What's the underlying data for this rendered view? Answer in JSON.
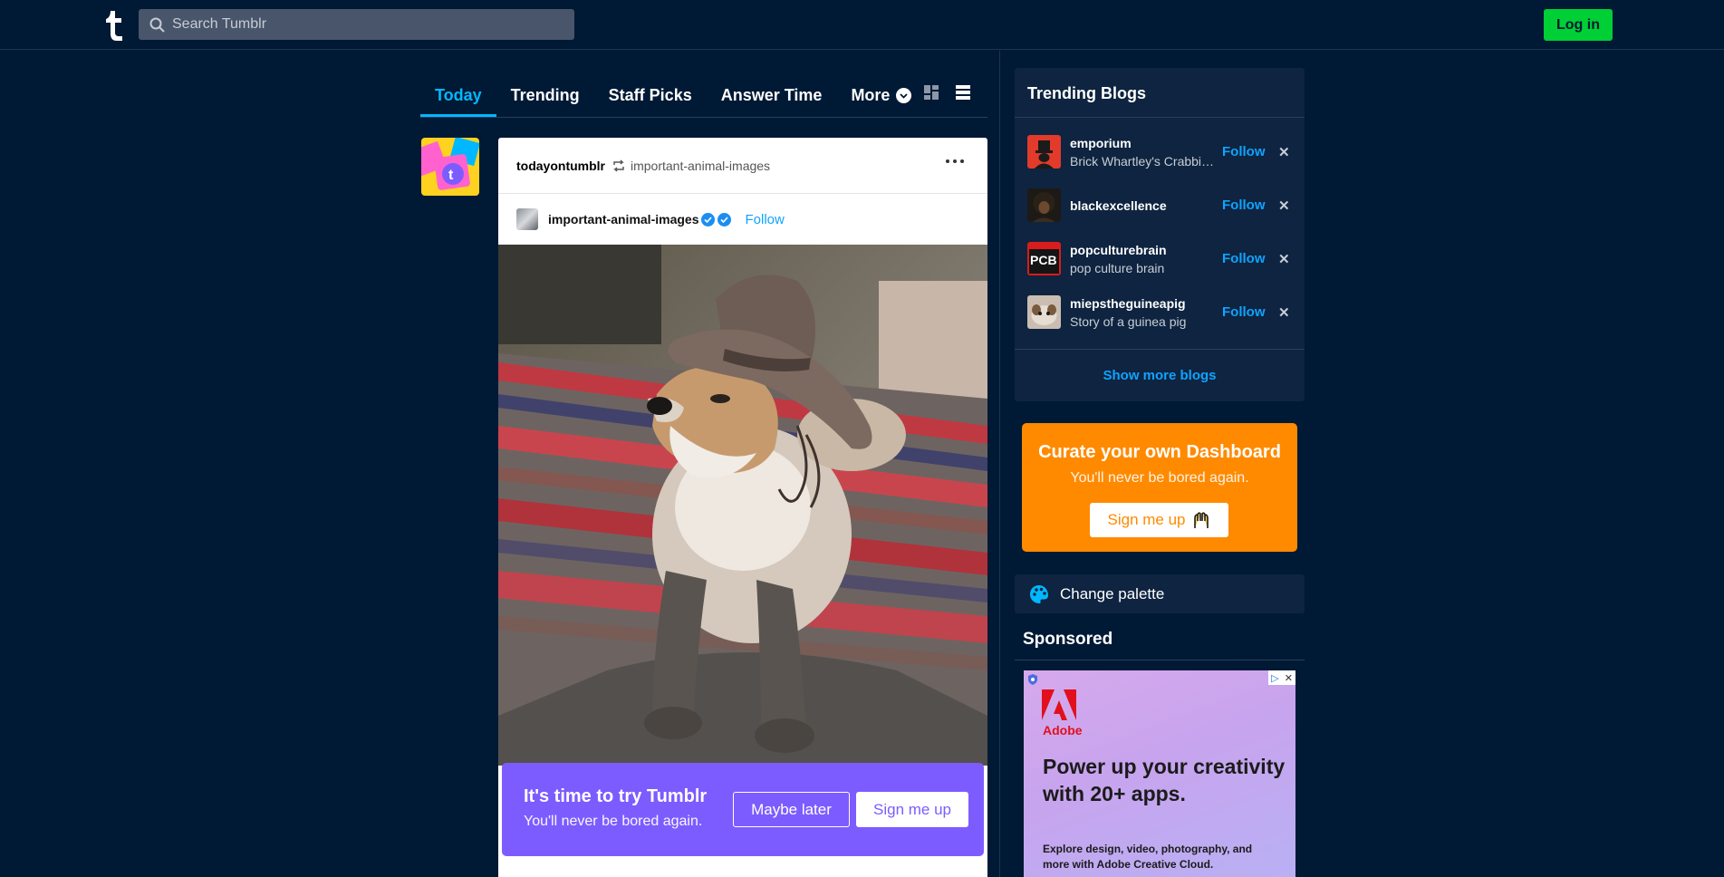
{
  "topbar": {
    "search_placeholder": "Search Tumblr",
    "login_label": "Log in"
  },
  "tabs": [
    {
      "label": "Today",
      "active": true
    },
    {
      "label": "Trending",
      "active": false
    },
    {
      "label": "Staff Picks",
      "active": false
    },
    {
      "label": "Answer Time",
      "active": false
    },
    {
      "label": "More",
      "active": false
    }
  ],
  "post": {
    "blog": "todayontumblr",
    "reblogged_from": "important-animal-images",
    "source_blog": "important-animal-images",
    "follow_label": "Follow"
  },
  "try_banner": {
    "title": "It's time to try Tumblr",
    "subtitle": "You'll never be bored again.",
    "maybe_label": "Maybe later",
    "signup_label": "Sign me up"
  },
  "trending": {
    "title": "Trending Blogs",
    "items": [
      {
        "name": "emporium",
        "desc": "Brick Whartley's Crabbing Emporium",
        "follow": "Follow"
      },
      {
        "name": "blackexcellence",
        "desc": "",
        "follow": "Follow"
      },
      {
        "name": "popculturebrain",
        "desc": "pop culture brain",
        "follow": "Follow"
      },
      {
        "name": "miepstheguineapig",
        "desc": "Story of a guinea pig",
        "follow": "Follow"
      }
    ],
    "show_more": "Show more blogs"
  },
  "curate": {
    "title": "Curate your own Dashboard",
    "subtitle": "You'll never be bored again.",
    "button": "Sign me up"
  },
  "palette_label": "Change palette",
  "sponsored_label": "Sponsored",
  "ad": {
    "brand": "Adobe",
    "headline": "Power up your creativity with 20+ apps.",
    "body": "Explore design, video, photography, and more with Adobe Creative Cloud."
  },
  "colors": {
    "background": "#001935",
    "accent": "#00b8ff",
    "login": "#00cf35",
    "banner": "#7c5cff",
    "curate": "#ff8a00"
  }
}
